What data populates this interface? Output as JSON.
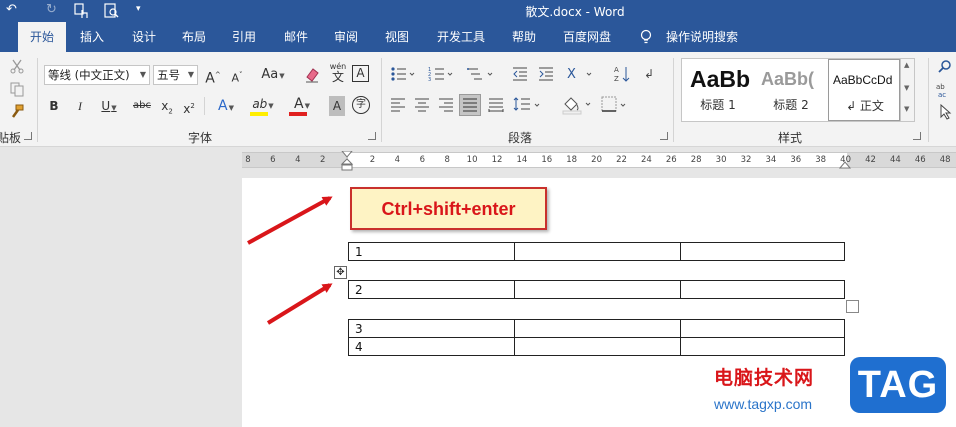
{
  "window": {
    "title": "散文.docx  -  Word"
  },
  "tabs": [
    {
      "label": "开始",
      "active": true
    },
    {
      "label": "插入"
    },
    {
      "label": "设计"
    },
    {
      "label": "布局"
    },
    {
      "label": "引用"
    },
    {
      "label": "邮件"
    },
    {
      "label": "审阅"
    },
    {
      "label": "视图"
    },
    {
      "label": "开发工具"
    },
    {
      "label": "帮助"
    },
    {
      "label": "百度网盘"
    },
    {
      "label": "操作说明搜索"
    }
  ],
  "ribbon": {
    "clipboard": {
      "label": "贴板"
    },
    "font": {
      "label": "字体",
      "font_name": "等线 (中文正文)",
      "font_size": "五号",
      "grow": "A",
      "shrink": "A",
      "case": "Aa",
      "phonetic": "wén",
      "phonetic_char": "文",
      "border_char": "A",
      "bold": "B",
      "italic": "I",
      "underline": "U",
      "strike": "abc",
      "subscript": "x",
      "superscript": "x",
      "effects": "A",
      "highlight": "ab",
      "font_color": "A",
      "shading": "A",
      "enclose": "字"
    },
    "paragraph": {
      "label": "段落"
    },
    "styles": {
      "label": "样式",
      "items": [
        {
          "sample": "AaBb",
          "name": "标题 1"
        },
        {
          "sample": "AaBb(",
          "name": "标题 2"
        },
        {
          "sample": "AaBbCcDd",
          "name": "↲ 正文"
        }
      ]
    }
  },
  "ruler": {
    "ticks": [
      "8",
      "6",
      "4",
      "2",
      "",
      "2",
      "4",
      "6",
      "8",
      "10",
      "12",
      "14",
      "16",
      "18",
      "20",
      "22",
      "24",
      "26",
      "28",
      "30",
      "32",
      "34",
      "36",
      "38",
      "40",
      "42",
      "44",
      "46",
      "48"
    ]
  },
  "document": {
    "callout": "Ctrl+shift+enter",
    "tables": [
      {
        "rows": [
          [
            "1",
            "",
            ""
          ]
        ]
      },
      {
        "rows": [
          [
            "2",
            "",
            ""
          ]
        ]
      },
      {
        "rows": [
          [
            "3",
            "",
            ""
          ],
          [
            "4",
            "",
            ""
          ]
        ]
      }
    ]
  },
  "watermark": {
    "text": "电脑技术网",
    "url": "www.tagxp.com",
    "logo": "TAG"
  },
  "colors": {
    "title_bar": "#2b579a",
    "callout_border": "#c9302c",
    "callout_text": "#d9161a",
    "arrow": "#d9161a"
  }
}
